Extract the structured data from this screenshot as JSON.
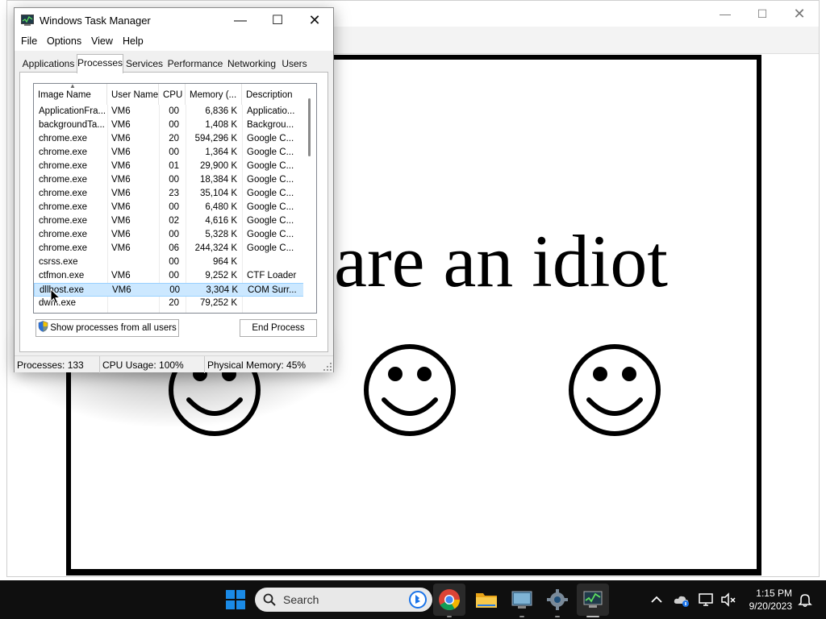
{
  "background_window": {
    "message": "are an idiot"
  },
  "task_manager": {
    "title": "Windows Task Manager",
    "menu": [
      "File",
      "Options",
      "View",
      "Help"
    ],
    "tabs": [
      "Applications",
      "Processes",
      "Services",
      "Performance",
      "Networking",
      "Users"
    ],
    "active_tab": "Processes",
    "columns": [
      "Image Name",
      "User Name",
      "CPU",
      "Memory (...",
      "Description"
    ],
    "processes": [
      {
        "name": "ApplicationFra...",
        "user": "VM6",
        "cpu": "00",
        "memory": "6,836 K",
        "description": "Applicatio..."
      },
      {
        "name": "backgroundTa...",
        "user": "VM6",
        "cpu": "00",
        "memory": "1,408 K",
        "description": "Backgrou..."
      },
      {
        "name": "chrome.exe",
        "user": "VM6",
        "cpu": "20",
        "memory": "594,296 K",
        "description": "Google C..."
      },
      {
        "name": "chrome.exe",
        "user": "VM6",
        "cpu": "00",
        "memory": "1,364 K",
        "description": "Google C..."
      },
      {
        "name": "chrome.exe",
        "user": "VM6",
        "cpu": "01",
        "memory": "29,900 K",
        "description": "Google C..."
      },
      {
        "name": "chrome.exe",
        "user": "VM6",
        "cpu": "00",
        "memory": "18,384 K",
        "description": "Google C..."
      },
      {
        "name": "chrome.exe",
        "user": "VM6",
        "cpu": "23",
        "memory": "35,104 K",
        "description": "Google C..."
      },
      {
        "name": "chrome.exe",
        "user": "VM6",
        "cpu": "00",
        "memory": "6,480 K",
        "description": "Google C..."
      },
      {
        "name": "chrome.exe",
        "user": "VM6",
        "cpu": "02",
        "memory": "4,616 K",
        "description": "Google C..."
      },
      {
        "name": "chrome.exe",
        "user": "VM6",
        "cpu": "00",
        "memory": "5,328 K",
        "description": "Google C..."
      },
      {
        "name": "chrome.exe",
        "user": "VM6",
        "cpu": "06",
        "memory": "244,324 K",
        "description": "Google C..."
      },
      {
        "name": "csrss.exe",
        "user": "",
        "cpu": "00",
        "memory": "964 K",
        "description": ""
      },
      {
        "name": "ctfmon.exe",
        "user": "VM6",
        "cpu": "00",
        "memory": "9,252 K",
        "description": "CTF Loader"
      },
      {
        "name": "dllhost.exe",
        "user": "VM6",
        "cpu": "00",
        "memory": "3,304 K",
        "description": "COM Surr..."
      },
      {
        "name": "dwm.exe",
        "user": "",
        "cpu": "20",
        "memory": "79,252 K",
        "description": ""
      }
    ],
    "selected_index": 13,
    "buttons": {
      "show_all": "Show processes from all users",
      "end_process": "End Process"
    },
    "status": {
      "processes": "Processes: 133",
      "cpu": "CPU Usage: 100%",
      "memory": "Physical Memory: 45%"
    }
  },
  "taskbar": {
    "search_label": "Search",
    "time": "1:15 PM",
    "date": "9/20/2023"
  },
  "colors": {
    "selection": "#cce8ff",
    "taskbar": "#0f0f0f",
    "start_blue": "#0078d4"
  }
}
